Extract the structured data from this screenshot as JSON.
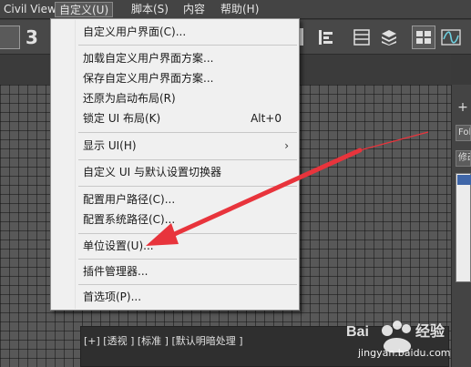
{
  "menubar": {
    "items": [
      {
        "label": "Civil View"
      },
      {
        "label": "自定义(U)"
      },
      {
        "label": "脚本(S)"
      },
      {
        "label": "内容"
      },
      {
        "label": "帮助(H)"
      }
    ]
  },
  "toolbar": {
    "snap_label": "3"
  },
  "dropdown": {
    "items": [
      {
        "label": "自定义用户界面(C)..."
      },
      {
        "label": "加载自定义用户界面方案..."
      },
      {
        "label": "保存自定义用户界面方案..."
      },
      {
        "label": "还原为启动布局(R)"
      },
      {
        "label": "锁定 UI 布局(K)",
        "shortcut": "Alt+0"
      },
      {
        "label": "显示 UI(H)",
        "submenu_arrow": "›"
      },
      {
        "label": "自定义 UI 与默认设置切换器"
      },
      {
        "label": "配置用户路径(C)..."
      },
      {
        "label": "配置系统路径(C)..."
      },
      {
        "label": "单位设置(U)..."
      },
      {
        "label": "插件管理器..."
      },
      {
        "label": "首选项(P)..."
      }
    ]
  },
  "viewport": {
    "label": "[+] [透视 ] [标准 ] [默认明暗处理 ]"
  },
  "command_panel": {
    "tab_1": "Fol",
    "tab_2": "修改"
  },
  "watermark": {
    "text": "jingyan.baidu.com"
  },
  "colors": {
    "menu_bg": "#f0f0f0",
    "app_bg": "#444444",
    "annotation_arrow": "#e8343c"
  }
}
